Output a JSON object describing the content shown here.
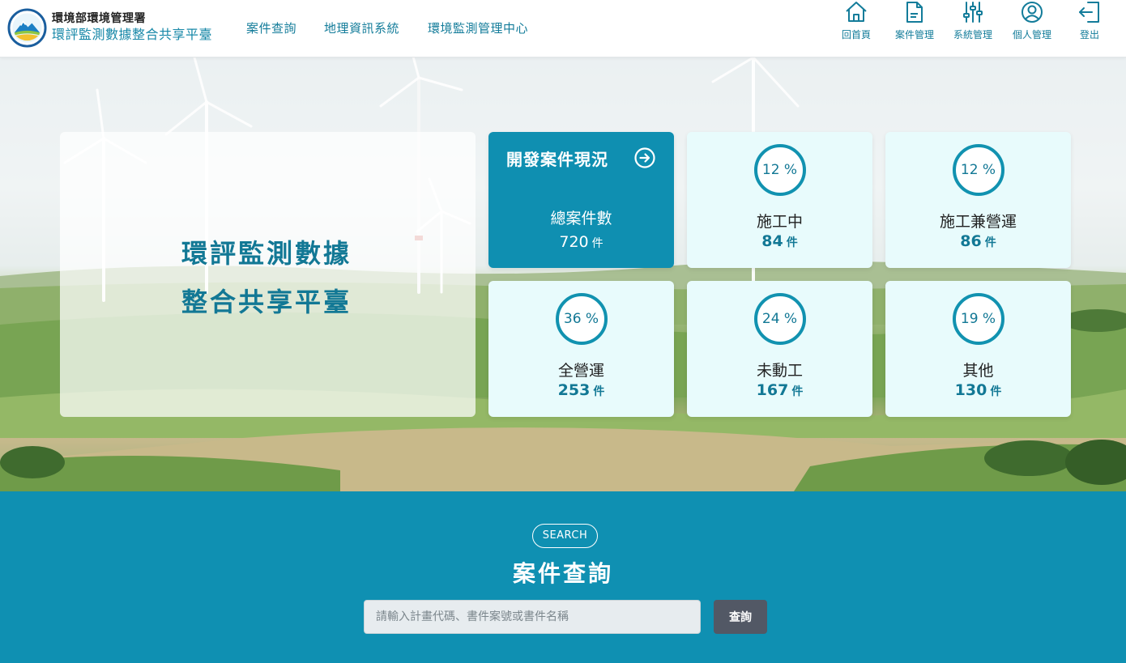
{
  "header": {
    "org_name": "環境部環境管理署",
    "system_name": "環評監測數據整合共享平臺",
    "nav": [
      {
        "label": "案件查詢"
      },
      {
        "label": "地理資訊系統"
      },
      {
        "label": "環境監測管理中心"
      }
    ],
    "tools": [
      {
        "label": "回首頁",
        "icon": "home-icon"
      },
      {
        "label": "案件管理",
        "icon": "document-icon"
      },
      {
        "label": "系統管理",
        "icon": "sliders-icon"
      },
      {
        "label": "個人管理",
        "icon": "user-icon"
      },
      {
        "label": "登出",
        "icon": "logout-icon"
      }
    ]
  },
  "hero": {
    "title_line1": "環評監測數據",
    "title_line2": "整合共享平臺"
  },
  "stats": {
    "heading": "開發案件現況",
    "total": {
      "label": "總案件數",
      "count": "720",
      "unit": "件"
    },
    "cards": [
      {
        "percent": "12 %",
        "label": "施工中",
        "count": "84",
        "unit": "件"
      },
      {
        "percent": "12 %",
        "label": "施工兼營運",
        "count": "86",
        "unit": "件"
      },
      {
        "percent": "36 %",
        "label": "全營運",
        "count": "253",
        "unit": "件"
      },
      {
        "percent": "24 %",
        "label": "未動工",
        "count": "167",
        "unit": "件"
      },
      {
        "percent": "19 %",
        "label": "其他",
        "count": "130",
        "unit": "件"
      }
    ]
  },
  "search": {
    "badge": "SEARCH",
    "title": "案件查詢",
    "placeholder": "請輸入計畫代碼、書件案號或書件名稱",
    "button": "查詢"
  },
  "colors": {
    "accent": "#0f90b2",
    "accent_dark": "#127895",
    "card_bg": "#e8fbfc",
    "button_dark": "#525865"
  }
}
